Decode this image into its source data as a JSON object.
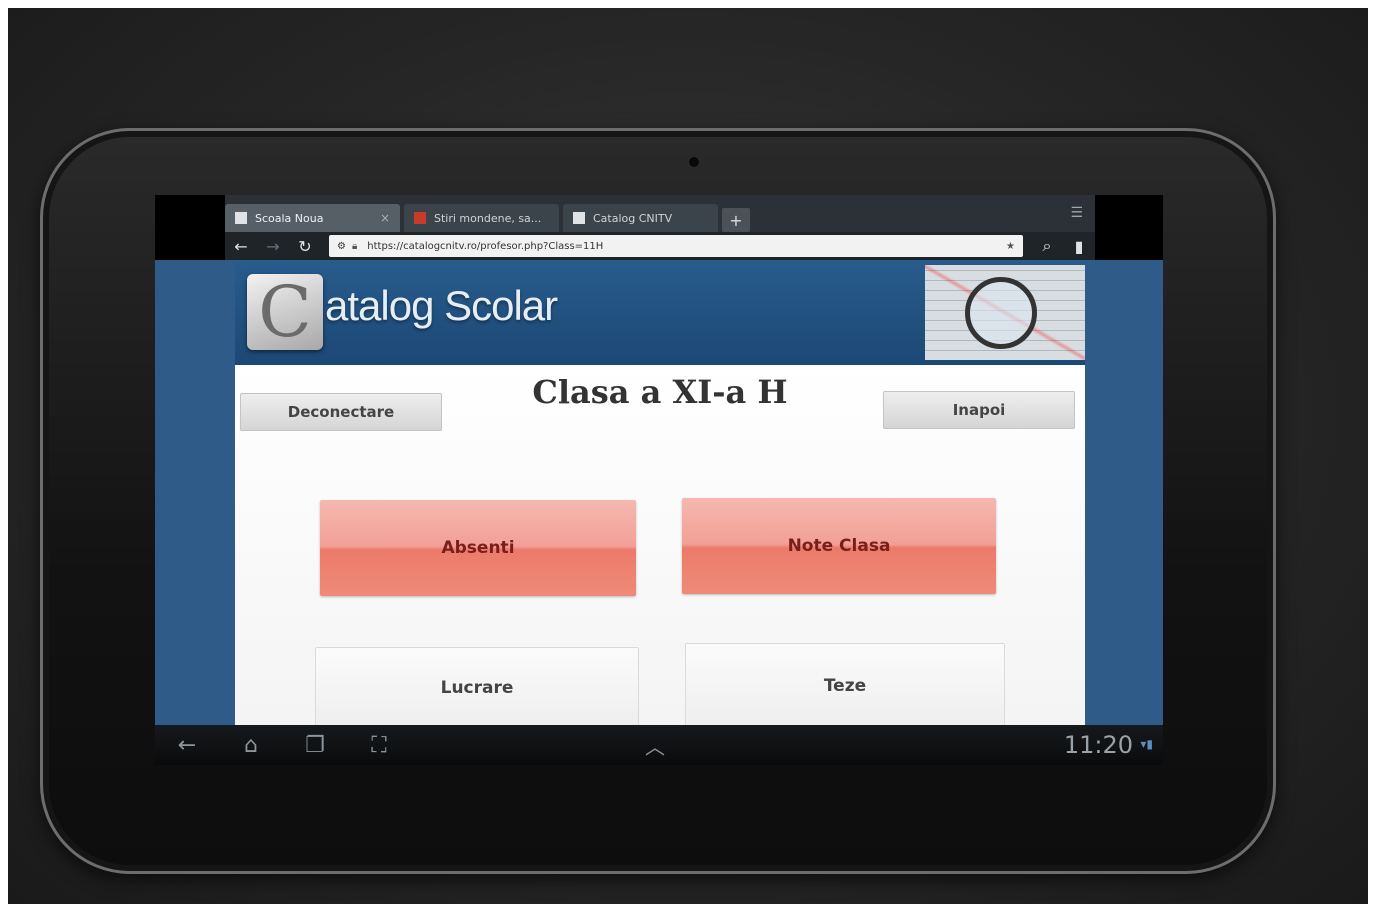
{
  "browser": {
    "tabs": [
      {
        "label": "Scoala Noua",
        "active": true,
        "close": "×"
      },
      {
        "label": "Stiri mondene, sa...",
        "active": false
      },
      {
        "label": "Catalog CNITV",
        "active": false
      }
    ],
    "new_tab": "+",
    "url": "https://catalogcnitv.ro/profesor.php?Class=11H"
  },
  "page": {
    "brand": "atalog Scolar",
    "brand_letter": "C",
    "title": "Clasa a XI-a H",
    "buttons": {
      "deconectare": "Deconectare",
      "inapoi": "Inapoi",
      "absenti": "Absenti",
      "note_clasa": "Note Clasa",
      "lucrare": "Lucrare",
      "teze": "Teze"
    }
  },
  "system_bar": {
    "clock": "11:20"
  },
  "colors": {
    "banner": "#1c4876",
    "primary_button": "#ec7a6a",
    "secondary_button": "#eeeeee"
  },
  "icons": [
    "back-icon",
    "forward-icon",
    "reload-icon",
    "lock-icon",
    "star-icon",
    "search-icon",
    "bookmarks-icon",
    "home-icon",
    "recent-apps-icon",
    "screenshot-icon",
    "menu-icon"
  ]
}
